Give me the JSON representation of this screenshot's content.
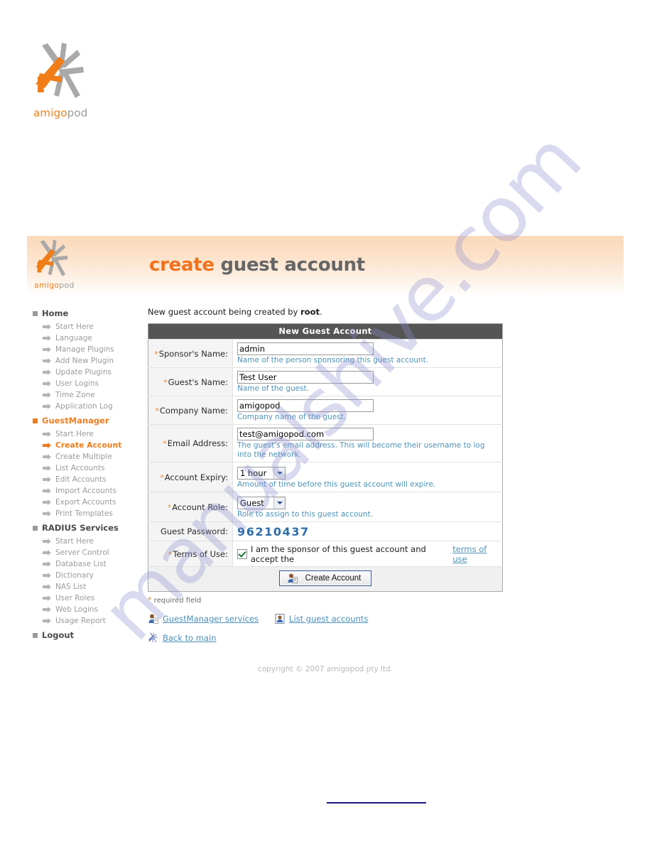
{
  "brand": {
    "word_part1": "amigo",
    "word_part2": "pod",
    "logo_icon": "amigopod-starburst-logo"
  },
  "header": {
    "title_accent": "create",
    "title_rest": " guest account"
  },
  "sidebar": {
    "sections": [
      {
        "label": "Home",
        "accent": false,
        "items": [
          {
            "label": "Start Here",
            "active": false
          },
          {
            "label": "Language",
            "active": false
          },
          {
            "label": "Manage Plugins",
            "active": false
          },
          {
            "label": "Add New Plugin",
            "active": false
          },
          {
            "label": "Update Plugins",
            "active": false
          },
          {
            "label": "User Logins",
            "active": false
          },
          {
            "label": "Time Zone",
            "active": false
          },
          {
            "label": "Application Log",
            "active": false
          }
        ]
      },
      {
        "label": "GuestManager",
        "accent": true,
        "items": [
          {
            "label": "Start Here",
            "active": false
          },
          {
            "label": "Create Account",
            "active": true
          },
          {
            "label": "Create Multiple",
            "active": false
          },
          {
            "label": "List Accounts",
            "active": false
          },
          {
            "label": "Edit Accounts",
            "active": false
          },
          {
            "label": "Import Accounts",
            "active": false
          },
          {
            "label": "Export Accounts",
            "active": false
          },
          {
            "label": "Print Templates",
            "active": false
          }
        ]
      },
      {
        "label": "RADIUS Services",
        "accent": false,
        "items": [
          {
            "label": "Start Here",
            "active": false
          },
          {
            "label": "Server Control",
            "active": false
          },
          {
            "label": "Database List",
            "active": false
          },
          {
            "label": "Dictionary",
            "active": false
          },
          {
            "label": "NAS List",
            "active": false
          },
          {
            "label": "User Roles",
            "active": false
          },
          {
            "label": "Web Logins",
            "active": false
          },
          {
            "label": "Usage Report",
            "active": false
          }
        ]
      },
      {
        "label": "Logout",
        "accent": false,
        "items": []
      }
    ]
  },
  "main": {
    "intro_prefix": "New guest account being created by ",
    "intro_user": "root",
    "intro_suffix": ".",
    "table_title": "New Guest Account",
    "fields": {
      "sponsor": {
        "label": "Sponsor's Name:",
        "required": true,
        "value": "admin",
        "hint": "Name of the person sponsoring this guest account."
      },
      "guest": {
        "label": "Guest's Name:",
        "required": true,
        "value": "Test User",
        "hint": "Name of the guest."
      },
      "company": {
        "label": "Company Name:",
        "required": true,
        "value": "amigopod",
        "hint": "Company name of the guest."
      },
      "email": {
        "label": "Email Address:",
        "required": true,
        "value": "test@amigopod.com",
        "hint": "The guest's email address. This will become their username to log into the network."
      },
      "expiry": {
        "label": "Account Expiry:",
        "required": true,
        "value": "1 hour",
        "hint": "Amount of time before this guest account will expire."
      },
      "role": {
        "label": "Account Role:",
        "required": true,
        "value": "Guest",
        "hint": "Role to assign to this guest account."
      },
      "password": {
        "label": "Guest Password:",
        "required": false,
        "value": "96210437"
      },
      "terms": {
        "label": "Terms of Use:",
        "required": true,
        "checkbox_text": "I am the sponsor of this guest account and accept the ",
        "link_text": "terms of use"
      }
    },
    "submit_label": "Create Account",
    "required_note_star": "*",
    "required_note": " required field"
  },
  "footer_links": [
    {
      "label": "GuestManager services",
      "icon": "user-services-icon"
    },
    {
      "label": "List guest accounts",
      "icon": "user-card-icon"
    },
    {
      "label": "Back to main",
      "icon": "amigopod-starburst-icon"
    }
  ],
  "copyright": "copyright © 2007 amigopod pty ltd.",
  "watermark": "manualshive.com",
  "colors": {
    "accent_orange": "#ef7f1a",
    "link_blue": "#4d93b5",
    "password_blue": "#2d6ea8",
    "header_grey": "#555555"
  }
}
